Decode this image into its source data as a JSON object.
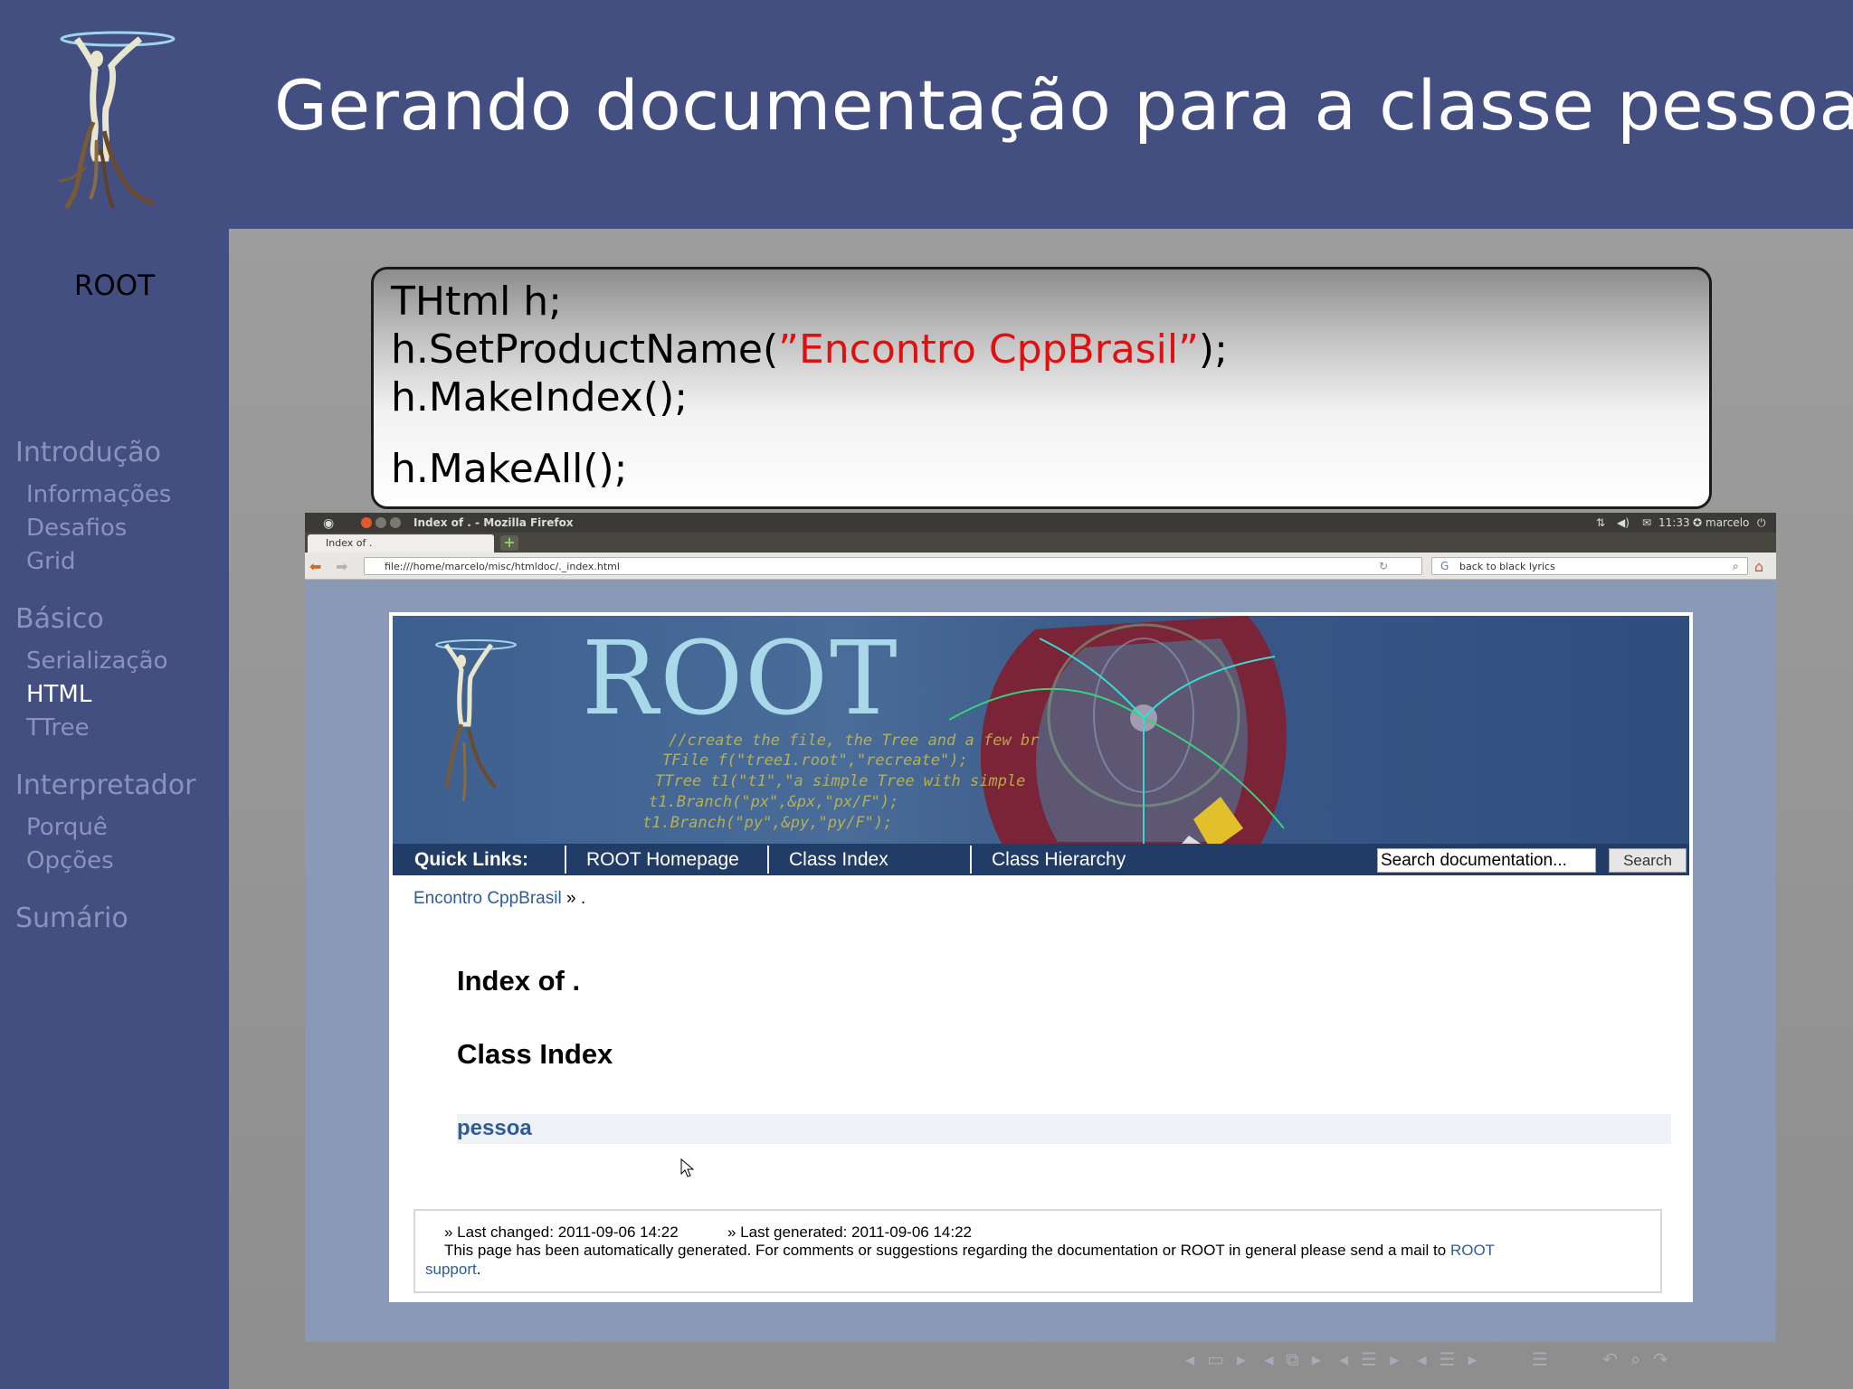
{
  "slide": {
    "title": "Gerando documentação para a classe pessoa",
    "sidebar_title": "ROOT",
    "colors": {
      "frame": "#434f80",
      "nav_inactive": "#8b93bd",
      "nav_active": "#ffffff",
      "code_string": "#e01010"
    }
  },
  "nav": [
    {
      "label": "Introdução",
      "level": 1,
      "active": false
    },
    {
      "label": "Informações",
      "level": 2,
      "active": false
    },
    {
      "label": "Desafios",
      "level": 2,
      "active": false
    },
    {
      "label": "Grid",
      "level": 2,
      "active": false
    },
    {
      "label": "Básico",
      "level": 1,
      "active": false
    },
    {
      "label": "Serialização",
      "level": 2,
      "active": false
    },
    {
      "label": "HTML",
      "level": 2,
      "active": true
    },
    {
      "label": "TTree",
      "level": 2,
      "active": false
    },
    {
      "label": "Interpretador",
      "level": 1,
      "active": false
    },
    {
      "label": "Porquê",
      "level": 2,
      "active": false
    },
    {
      "label": "Opções",
      "level": 2,
      "active": false
    },
    {
      "label": "Sumário",
      "level": 1,
      "active": false
    }
  ],
  "code": {
    "line1": "THtml  h;",
    "line2_pre": "h.SetProductName(",
    "line2_str": "”Encontro  CppBrasil”",
    "line2_post": ");",
    "line3": "h.MakeIndex();",
    "line4": "h.MakeAll();"
  },
  "browser": {
    "window_title": "Index of . - Mozilla Firefox",
    "clock": "11:33",
    "user": "marcelo",
    "tab_label": "Index of .",
    "new_tab": "+",
    "url": "file:///home/marcelo/misc/htmldoc/._index.html",
    "search_value": "back to black lyrics"
  },
  "root_page": {
    "banner_title": "ROOT",
    "banner_code": [
      "//create the file, the Tree and a few br",
      "TFile f(\"tree1.root\",\"recreate\");",
      "TTree t1(\"t1\",\"a simple Tree with simple",
      "t1.Branch(\"px\",&px,\"px/F\");",
      "t1.Branch(\"py\",&py,\"py/F\");"
    ],
    "quick_links_label": "Quick Links:",
    "links": [
      "ROOT Homepage",
      "Class Index",
      "Class Hierarchy"
    ],
    "search_placeholder": "Search documentation...",
    "search_button": "Search",
    "breadcrumb_link": "Encontro CppBrasil",
    "breadcrumb_rest": " » .",
    "heading_index": "Index of .",
    "heading_class_index": "Class Index",
    "class_name": "pessoa",
    "footer_changed": "» Last changed: 2011-09-06 14:22",
    "footer_generated": "» Last generated: 2011-09-06 14:22",
    "footer_text": "This page has been automatically generated. For comments or suggestions regarding the documentation or ROOT in general please send a mail to ",
    "footer_link1": "ROOT",
    "footer_link2": "support",
    "footer_end": "."
  }
}
